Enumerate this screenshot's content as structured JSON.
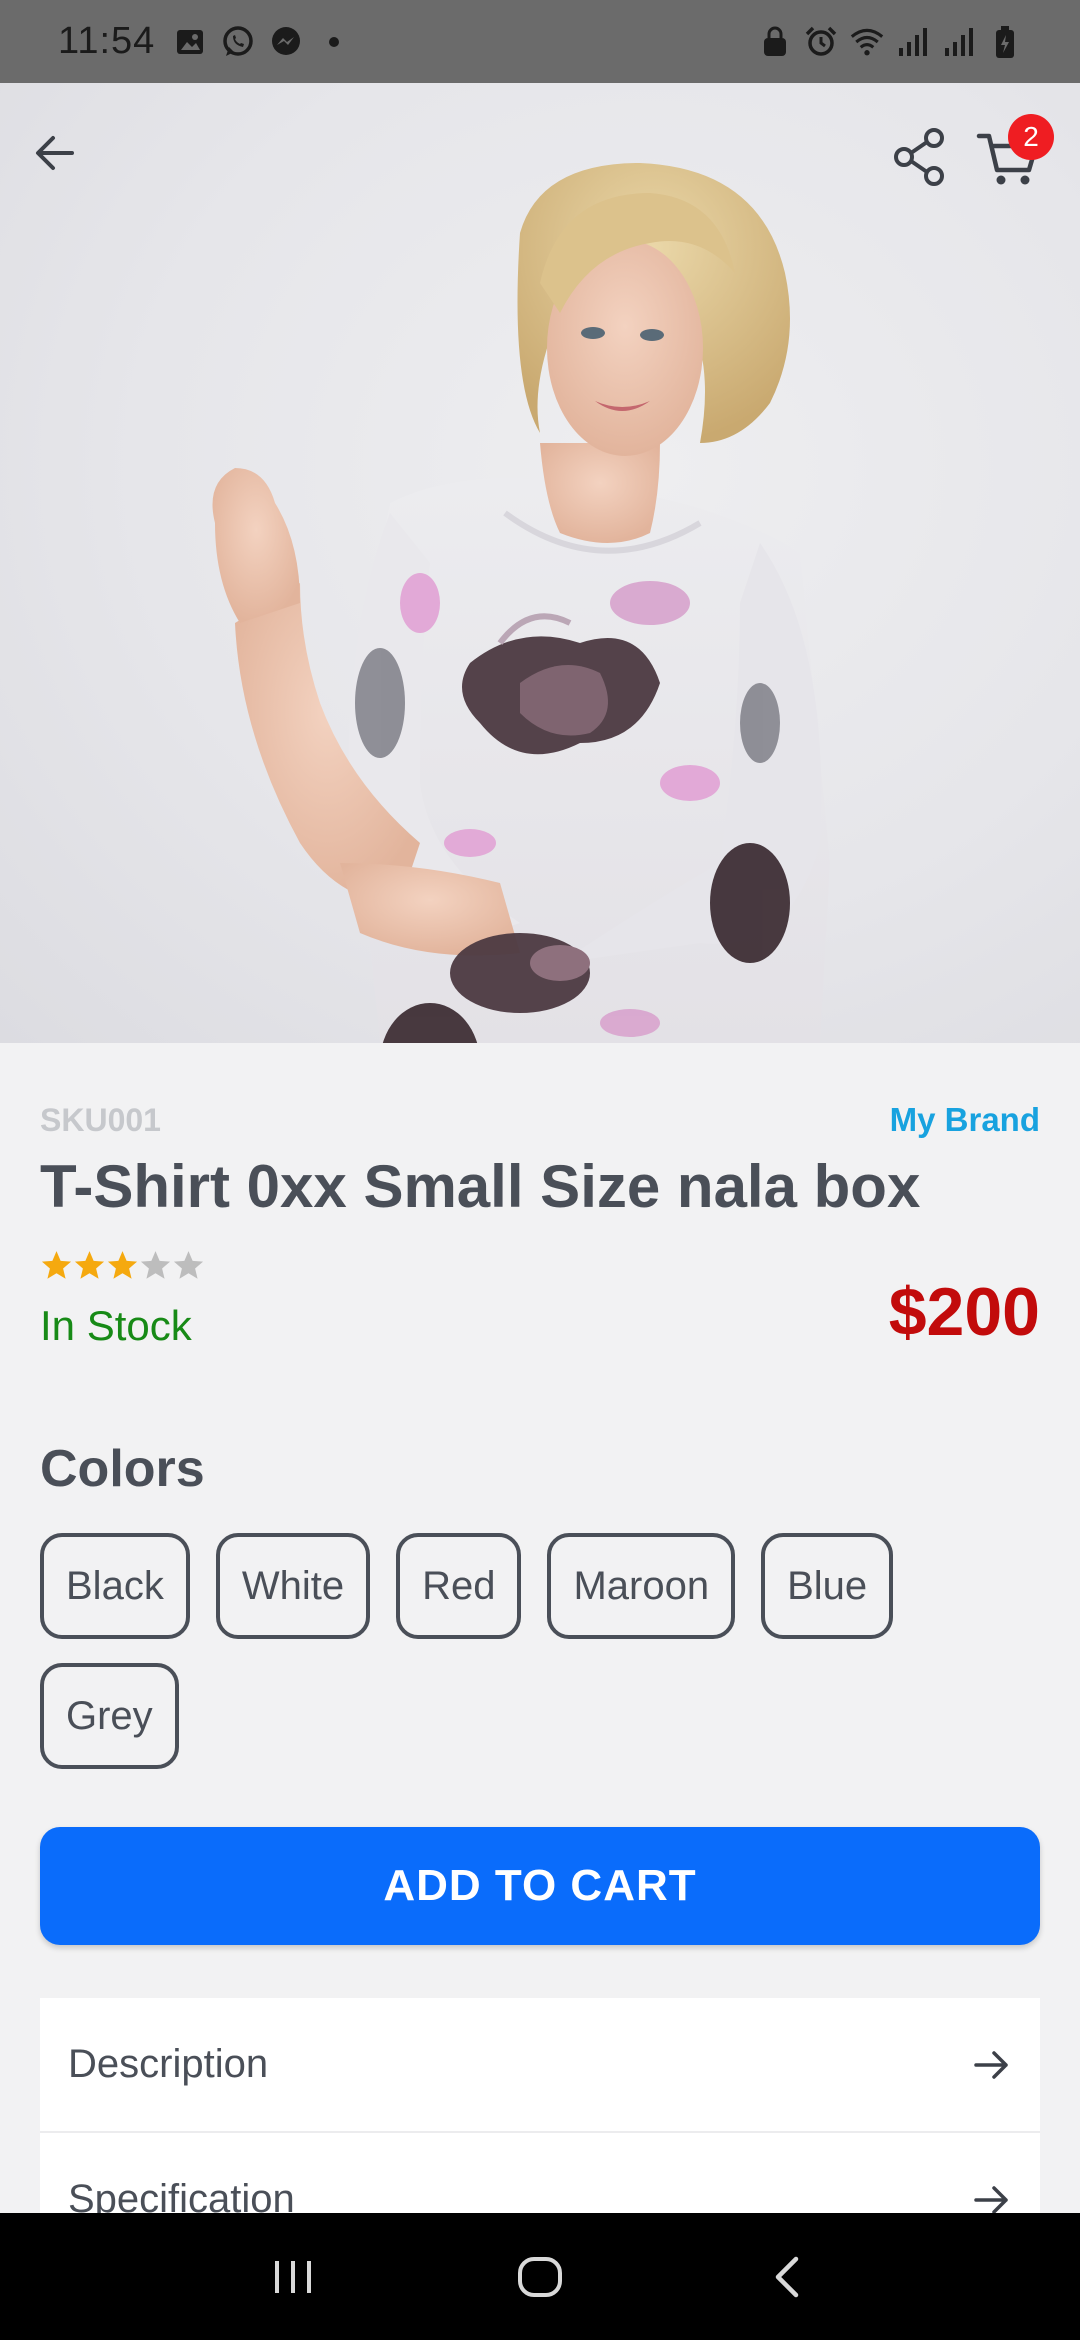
{
  "status_bar": {
    "time": "11:54",
    "left_icons": [
      "image-icon",
      "whatsapp-icon",
      "messenger-icon",
      "dot-icon"
    ],
    "right_icons": [
      "lock-icon",
      "alarm-icon",
      "wifi-icon",
      "signal-icon",
      "signal-icon",
      "battery-icon"
    ]
  },
  "header": {
    "back_icon": "arrow-left-icon",
    "share_icon": "share-icon",
    "cart_icon": "cart-icon",
    "cart_count": "2"
  },
  "product": {
    "sku": "SKU001",
    "brand": "My Brand",
    "title": "T-Shirt 0xx Small Size nala box",
    "rating": 3,
    "rating_max": 5,
    "stock": "In Stock",
    "price": "$200"
  },
  "colors": {
    "title": "Colors",
    "options": [
      "Black",
      "White",
      "Red",
      "Maroon",
      "Blue",
      "Grey"
    ]
  },
  "actions": {
    "add_to_cart": "ADD TO CART"
  },
  "info_sections": [
    {
      "label": "Description"
    },
    {
      "label": "Specification"
    }
  ],
  "theme": {
    "accent": "#0a6cfb",
    "price_color": "#c20b0b",
    "stock_color": "#178a16",
    "brand_color": "#18a2df",
    "star_filled": "#f5a90f",
    "star_empty": "#bdbdbd",
    "badge": "#ef1d22"
  }
}
